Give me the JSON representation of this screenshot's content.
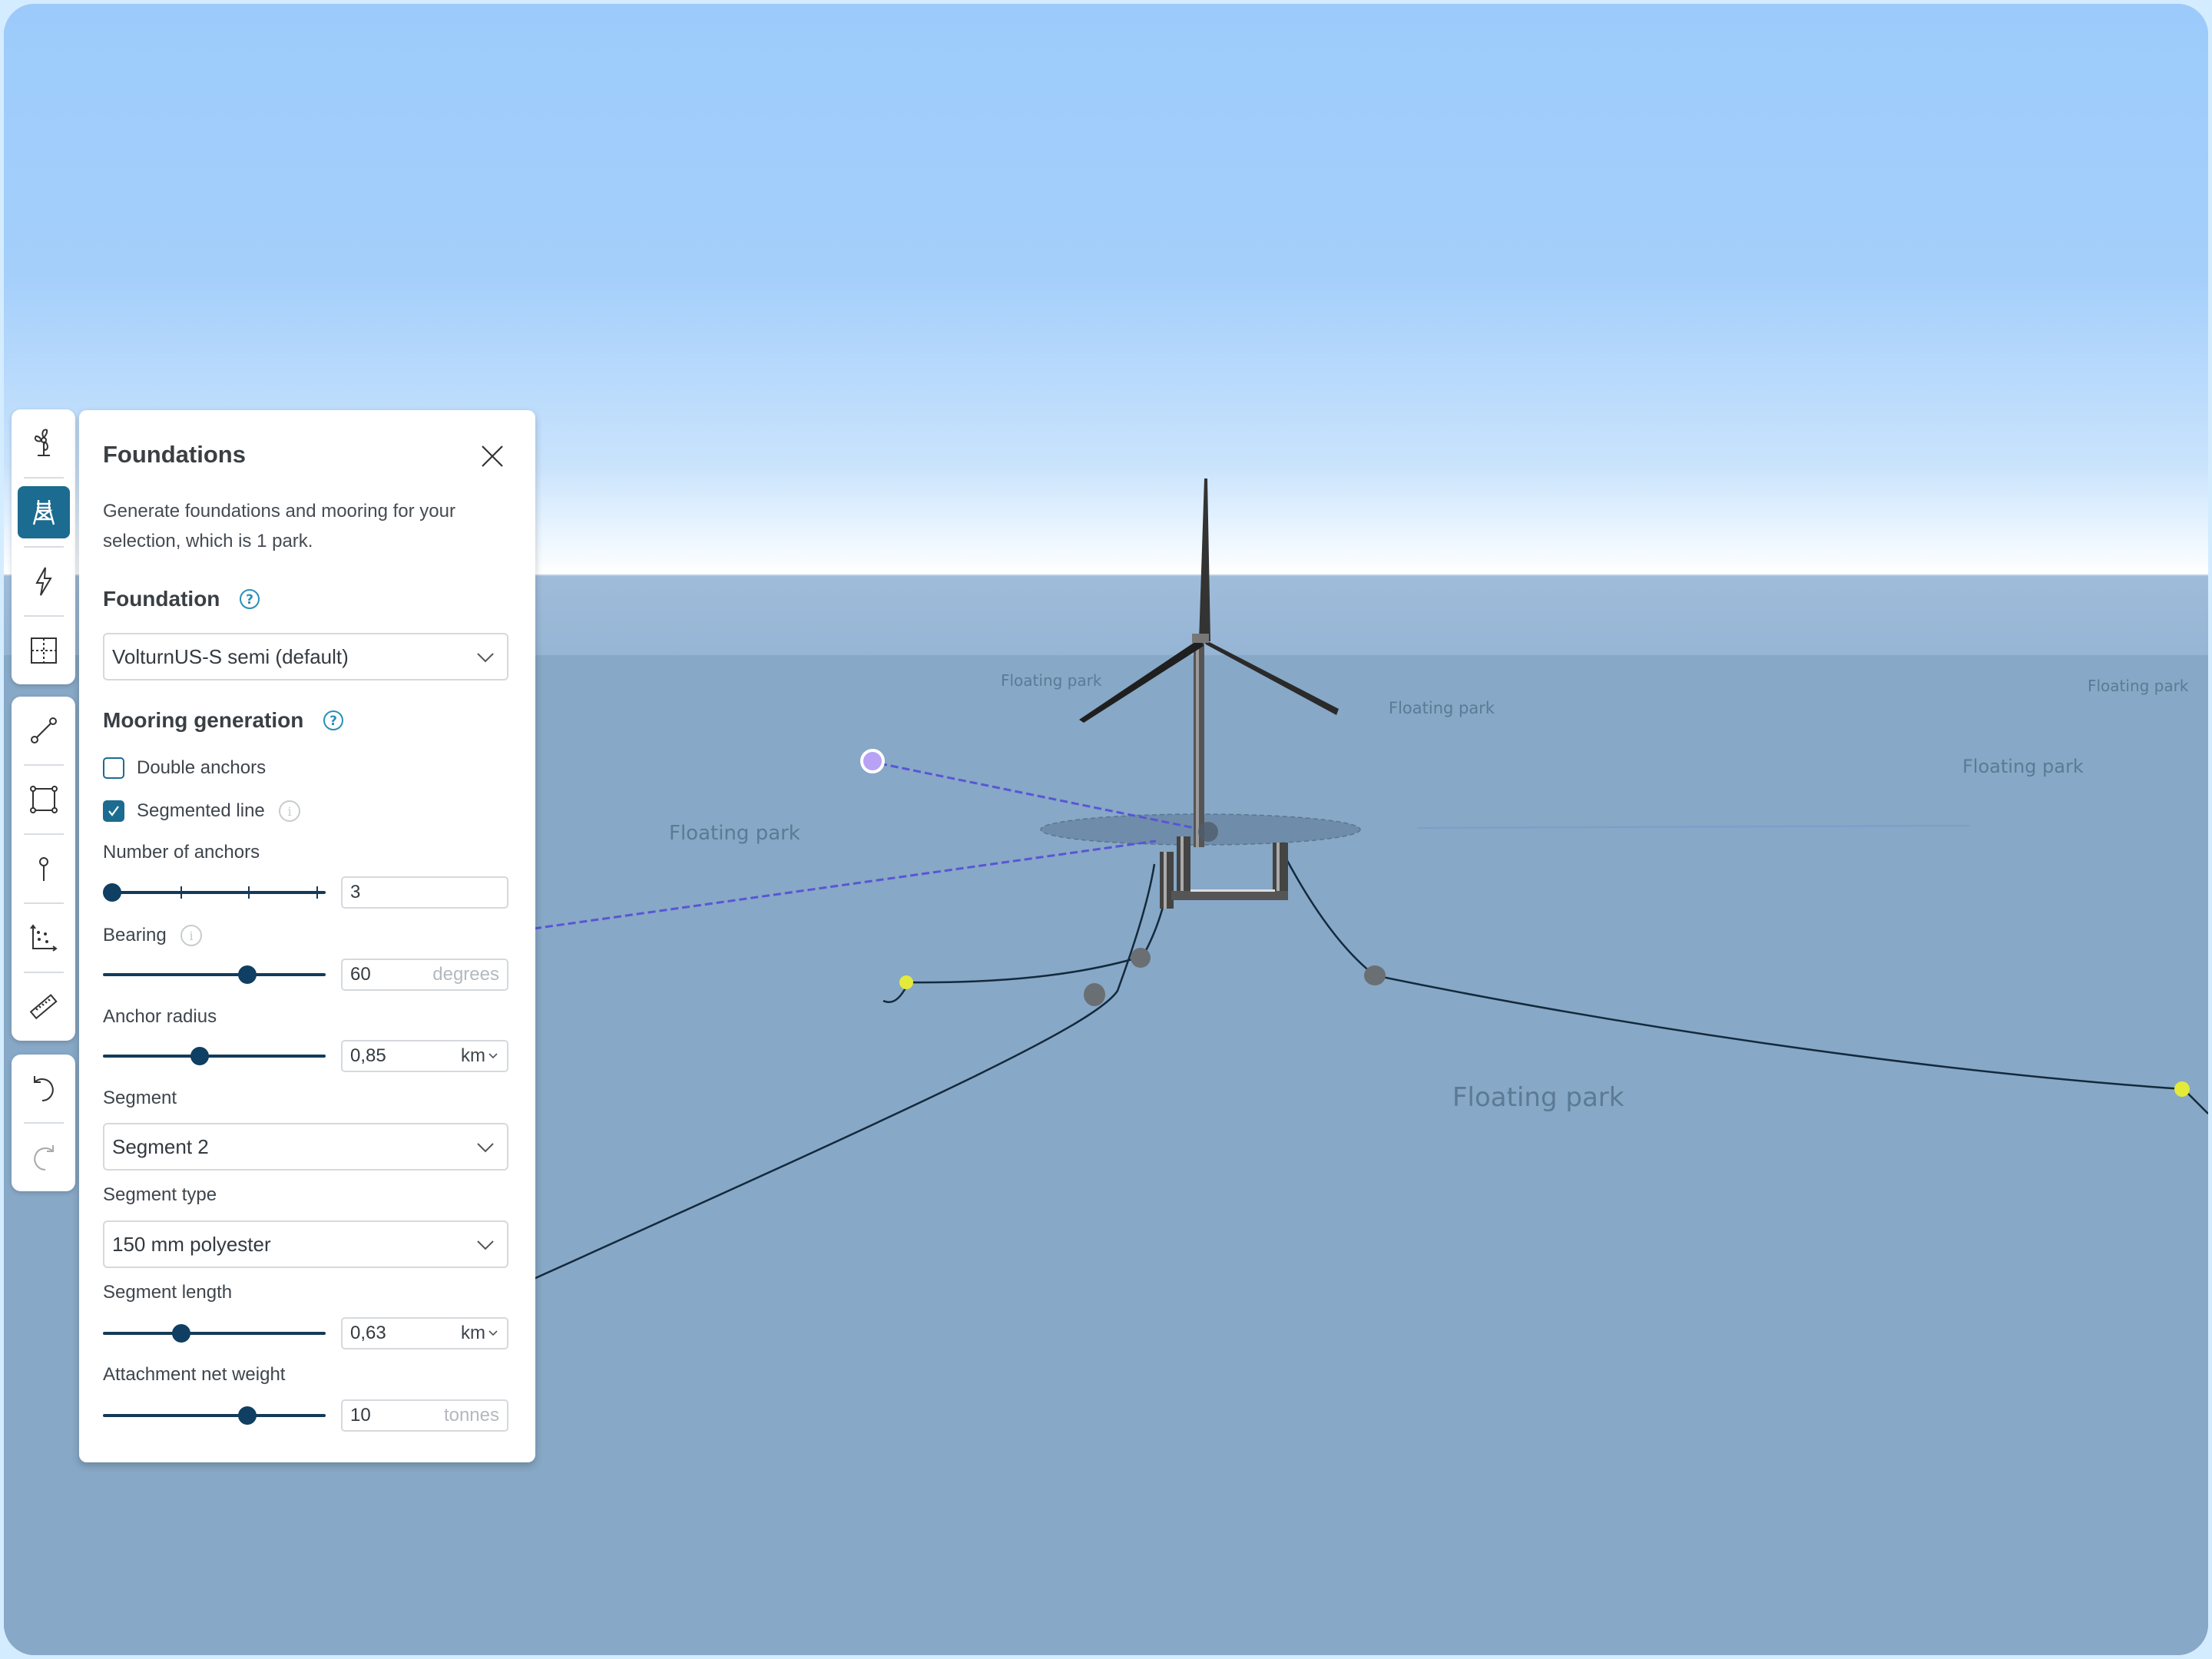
{
  "scene": {
    "park_labels": [
      "Floating park",
      "Floating park",
      "Floating park",
      "Floating park",
      "Floating park",
      "Floating park"
    ],
    "colors": {
      "sky": "#9ccbfb",
      "sea": "#87a8c6",
      "selection_line": "#5a55d6",
      "mooring_line": "#13293d",
      "anchor": "#e4ea3a",
      "attachment": "#6e7378",
      "selection_handle": "#b7a2f5"
    }
  },
  "toolbar": {
    "groups": [
      [
        {
          "name": "turbine-icon",
          "label": "Turbines",
          "active": false
        },
        {
          "name": "foundation-icon",
          "label": "Foundations",
          "active": true
        },
        {
          "name": "lightning-icon",
          "label": "Electrical",
          "active": false
        },
        {
          "name": "grid-icon",
          "label": "Layout grid",
          "active": false
        }
      ],
      [
        {
          "name": "line-tool-icon",
          "label": "Draw line",
          "active": false
        },
        {
          "name": "polygon-tool-icon",
          "label": "Draw polygon",
          "active": false
        },
        {
          "name": "point-tool-icon",
          "label": "Draw point",
          "active": false
        },
        {
          "name": "scatter-axes-icon",
          "label": "Analysis",
          "active": false
        },
        {
          "name": "ruler-icon",
          "label": "Measure",
          "active": false
        }
      ],
      [
        {
          "name": "undo-icon",
          "label": "Undo",
          "active": false
        },
        {
          "name": "redo-icon",
          "label": "Redo",
          "active": false,
          "disabled": true
        }
      ]
    ]
  },
  "panel": {
    "title": "Foundations",
    "description": "Generate foundations and mooring for your selection, which is 1 park.",
    "foundation": {
      "section_title": "Foundation",
      "selected": "VolturnUS-S semi (default)"
    },
    "mooring": {
      "section_title": "Mooring generation",
      "double_anchors": {
        "label": "Double anchors",
        "checked": false
      },
      "segmented_line": {
        "label": "Segmented line",
        "checked": true
      },
      "number_of_anchors": {
        "label": "Number of anchors",
        "value": "3",
        "slider_fraction": 0.0,
        "ticks": 4
      },
      "bearing": {
        "label": "Bearing",
        "value": "60",
        "unit": "degrees",
        "slider_fraction": 0.66
      },
      "anchor_radius": {
        "label": "Anchor radius",
        "value": "0,85",
        "unit": "km",
        "slider_fraction": 0.43
      },
      "segment": {
        "label": "Segment",
        "selected": "Segment 2"
      },
      "segment_type": {
        "label": "Segment type",
        "selected": "150 mm polyester"
      },
      "segment_length": {
        "label": "Segment length",
        "value": "0,63",
        "unit": "km",
        "slider_fraction": 0.34
      },
      "attachment_net_weight": {
        "label": "Attachment net weight",
        "value": "10",
        "unit": "tonnes",
        "slider_fraction": 0.66
      }
    }
  },
  "accent_color": "#1c6b90"
}
